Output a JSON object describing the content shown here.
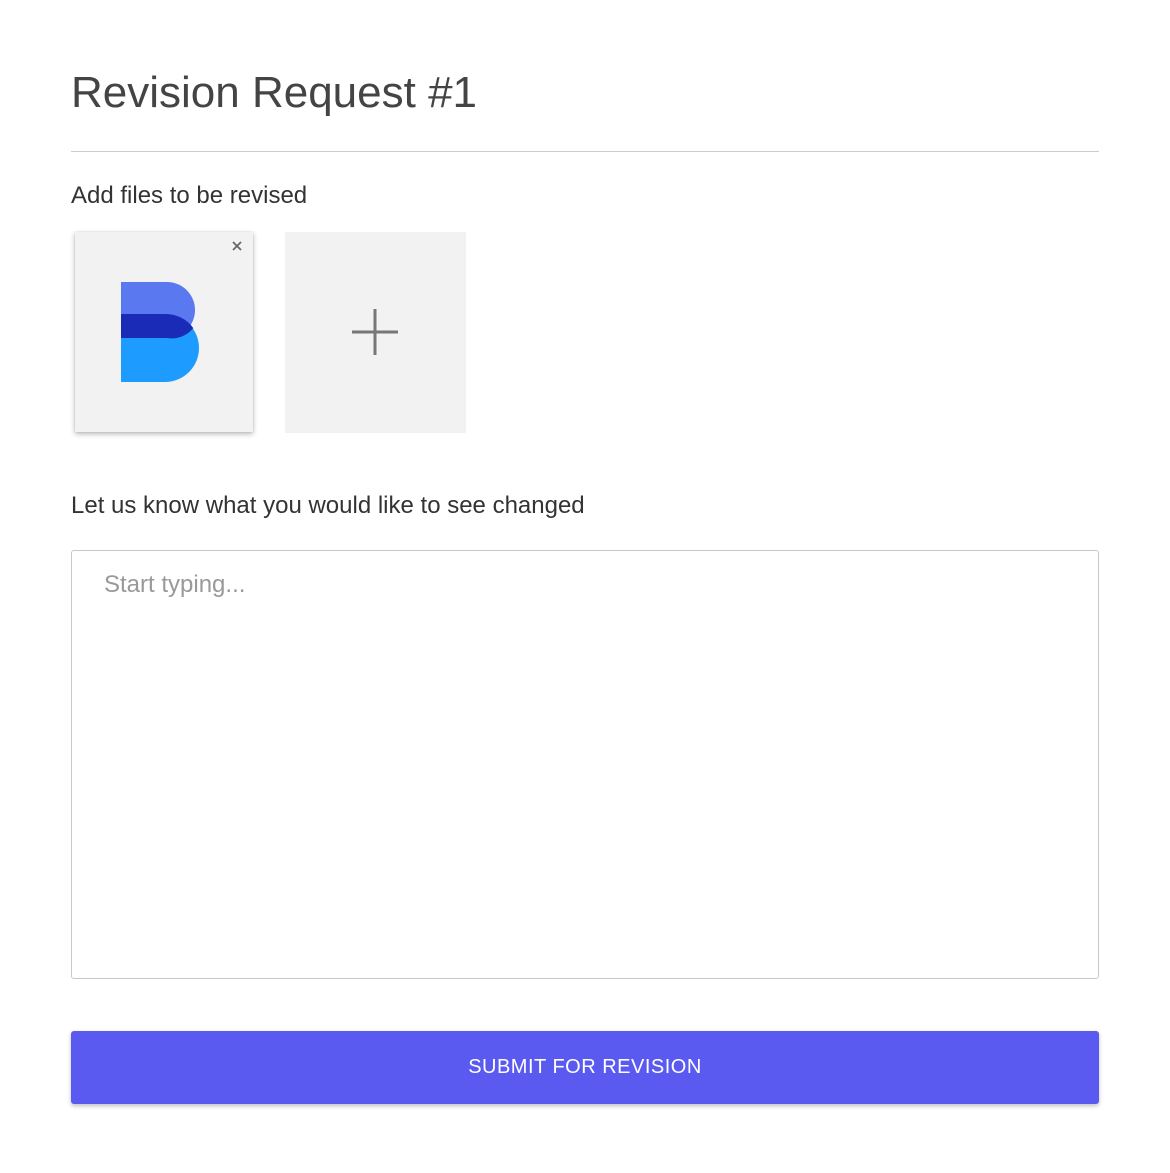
{
  "form": {
    "title": "Revision Request #1",
    "files_label": "Add files to be revised",
    "changes_label": "Let us know what you would like to see changed",
    "notes_placeholder": "Start typing...",
    "notes_value": "",
    "submit_label": "SUBMIT FOR REVISION"
  },
  "files": [
    {
      "icon": "brand-b-logo-icon",
      "remove_icon": "close-icon"
    }
  ],
  "add_file": {
    "icon": "plus-icon"
  },
  "colors": {
    "accent": "#5a5af0",
    "logo_top": "#5a78f0",
    "logo_middle": "#1a2bb8",
    "logo_bottom": "#1e9bff",
    "tile_background": "#f2f2f2"
  }
}
